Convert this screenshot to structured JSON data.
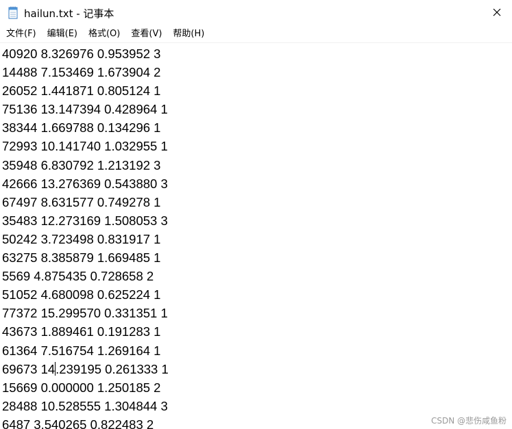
{
  "window": {
    "title": "hailun.txt - 记事本"
  },
  "menu": {
    "items": [
      "文件(F)",
      "编辑(E)",
      "格式(O)",
      "查看(V)",
      "帮助(H)"
    ]
  },
  "editor": {
    "lines": [
      "40920 8.326976 0.953952 3",
      "14488 7.153469 1.673904 2",
      "26052 1.441871 0.805124 1",
      "75136 13.147394 0.428964 1",
      "38344 1.669788 0.134296 1",
      "72993 10.141740 1.032955 1",
      "35948 6.830792 1.213192 3",
      "42666 13.276369 0.543880 3",
      "67497 8.631577 0.749278 1",
      "35483 12.273169 1.508053 3",
      "50242 3.723498 0.831917 1",
      "63275 8.385879 1.669485 1",
      "5569 4.875435 0.728658 2",
      "51052 4.680098 0.625224 1",
      "77372 15.299570 0.331351 1",
      "43673 1.889461 0.191283 1",
      "61364 7.516754 1.269164 1",
      "69673 14.239195 0.261333 1",
      "15669 0.000000 1.250185 2",
      "28488 10.528555 1.304844 3",
      "6487 3.540265 0.822483 2"
    ],
    "caret": {
      "line": 17,
      "column": 8
    }
  },
  "watermark": {
    "text": "CSDN @悲伤咸鱼粉"
  },
  "icons": {
    "app": "notepad-icon",
    "close": "close-icon"
  }
}
